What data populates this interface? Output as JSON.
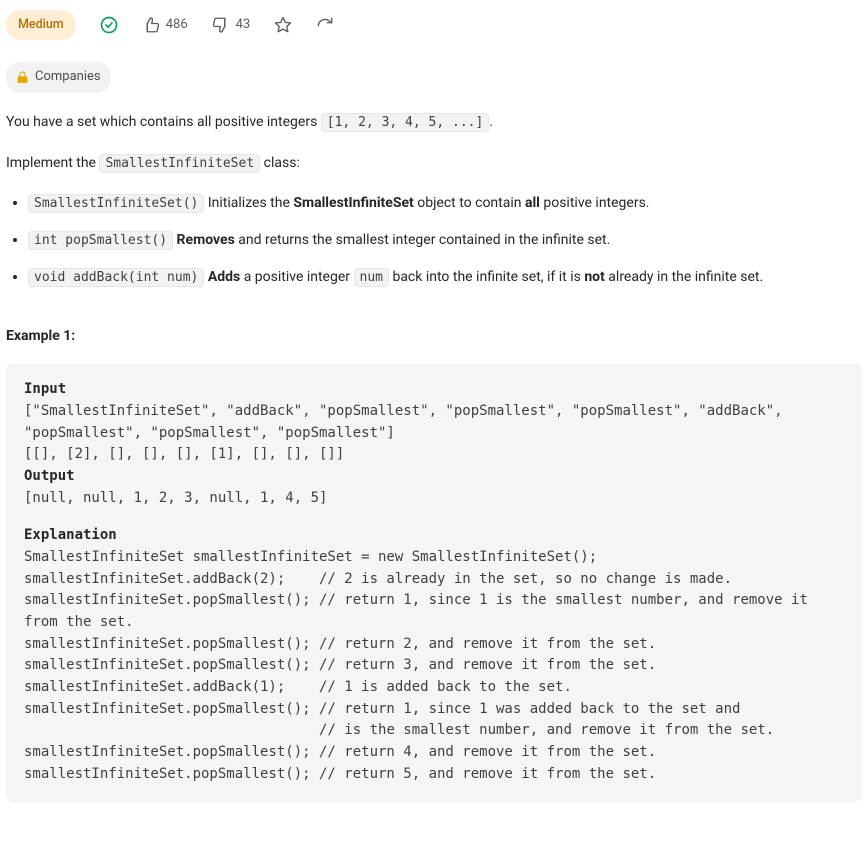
{
  "header": {
    "difficulty": "Medium",
    "likes": "486",
    "dislikes": "43",
    "companies_label": "Companies"
  },
  "desc": {
    "intro_before": "You have a set which contains all positive integers ",
    "intro_code": "[1, 2, 3, 4, 5, ...]",
    "intro_after": ".",
    "impl_before": "Implement the ",
    "impl_code": "SmallestInfiniteSet",
    "impl_after": " class:"
  },
  "api": [
    {
      "sig": "SmallestInfiniteSet()",
      "parts": [
        {
          "t": " Initializes the "
        },
        {
          "t": "SmallestInfiniteSet",
          "b": true
        },
        {
          "t": " object to contain "
        },
        {
          "t": "all",
          "b": true
        },
        {
          "t": " positive integers."
        }
      ]
    },
    {
      "sig": "int popSmallest()",
      "parts": [
        {
          "t": " "
        },
        {
          "t": "Removes",
          "b": true
        },
        {
          "t": " and returns the smallest integer contained in the infinite set."
        }
      ]
    },
    {
      "sig": "void addBack(int num)",
      "parts": [
        {
          "t": " "
        },
        {
          "t": "Adds",
          "b": true
        },
        {
          "t": " a positive integer "
        },
        {
          "t": "num",
          "code": true
        },
        {
          "t": " back into the infinite set, if it is "
        },
        {
          "t": "not",
          "b": true
        },
        {
          "t": " already in the infinite set."
        }
      ]
    }
  ],
  "example": {
    "label": "Example 1:",
    "input_head": "Input",
    "input_body": "[\"SmallestInfiniteSet\", \"addBack\", \"popSmallest\", \"popSmallest\", \"popSmallest\", \"addBack\", \"popSmallest\", \"popSmallest\", \"popSmallest\"]\n[[], [2], [], [], [], [1], [], [], []]",
    "output_head": "Output",
    "output_body": "[null, null, 1, 2, 3, null, 1, 4, 5]",
    "explanation_head": "Explanation",
    "explanation_body": "SmallestInfiniteSet smallestInfiniteSet = new SmallestInfiniteSet();\nsmallestInfiniteSet.addBack(2);    // 2 is already in the set, so no change is made.\nsmallestInfiniteSet.popSmallest(); // return 1, since 1 is the smallest number, and remove it from the set.\nsmallestInfiniteSet.popSmallest(); // return 2, and remove it from the set.\nsmallestInfiniteSet.popSmallest(); // return 3, and remove it from the set.\nsmallestInfiniteSet.addBack(1);    // 1 is added back to the set.\nsmallestInfiniteSet.popSmallest(); // return 1, since 1 was added back to the set and\n                                   // is the smallest number, and remove it from the set.\nsmallestInfiniteSet.popSmallest(); // return 4, and remove it from the set.\nsmallestInfiniteSet.popSmallest(); // return 5, and remove it from the set."
  }
}
